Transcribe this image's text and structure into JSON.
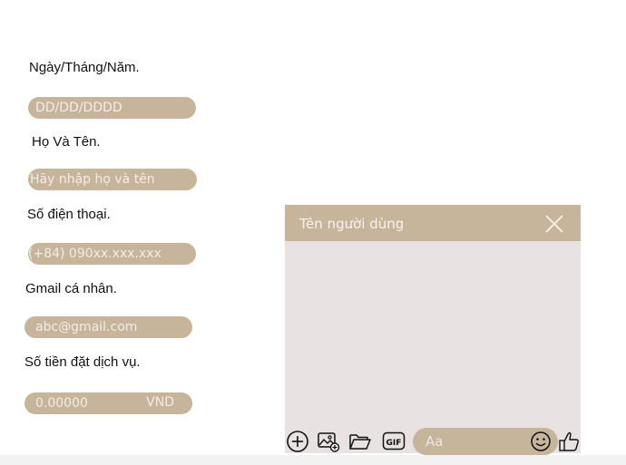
{
  "form": {
    "date_label": "Ngày/Tháng/Năm.",
    "date_placeholder": "DD/DD/DDDD",
    "name_label": "Họ Và Tên.",
    "name_placeholder": "Hãy nhập họ và tên",
    "phone_label": "Số điện thoại.",
    "phone_placeholder": "(+84) 090xx.xxx.xxx",
    "gmail_label": "Gmail cá nhân.",
    "gmail_placeholder": "abc@gmail.com",
    "amount_label": "Số tiền đặt dịch vụ.",
    "amount_value": "0.00000",
    "amount_unit": "VND"
  },
  "chat": {
    "title": "Tên người dùng",
    "input_placeholder": "Aa",
    "toolbar_icons": [
      "plus-circle-icon",
      "image-icon",
      "folder-icon",
      "gif-icon",
      "emoji-icon",
      "thumbs-up-icon"
    ]
  },
  "colors": {
    "accent": "#c6b49b",
    "chat_background": "#e8e3e2",
    "placeholder_text": "#f3ede4"
  }
}
